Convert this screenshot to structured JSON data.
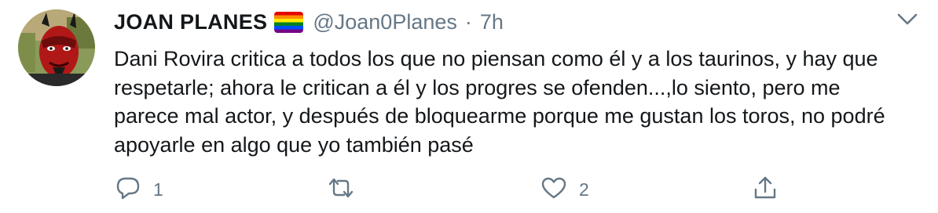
{
  "tweet": {
    "author": {
      "display_name": "JOAN PLANES",
      "badge_icon": "rainbow-flag-icon",
      "handle": "@Joan0Planes",
      "avatar_icon": "devil-mask-avatar"
    },
    "separator": "·",
    "time": "7h",
    "menu_icon": "chevron-down-icon",
    "text": "Dani Rovira critica a todos los que no piensan como él y a los taurinos, y hay que respetarle; ahora le critican a él y los progres se ofenden...,lo siento, pero me parece mal actor, y después de bloquearme porque me gustan los toros, no podré apoyarle en algo que yo también pasé",
    "actions": {
      "reply": {
        "icon": "reply-icon",
        "count": "1"
      },
      "retweet": {
        "icon": "retweet-icon",
        "count": ""
      },
      "like": {
        "icon": "heart-icon",
        "count": "2"
      },
      "share": {
        "icon": "share-icon",
        "count": ""
      }
    }
  },
  "colors": {
    "text_primary": "#14171a",
    "text_secondary": "#657786",
    "background": "#ffffff"
  }
}
